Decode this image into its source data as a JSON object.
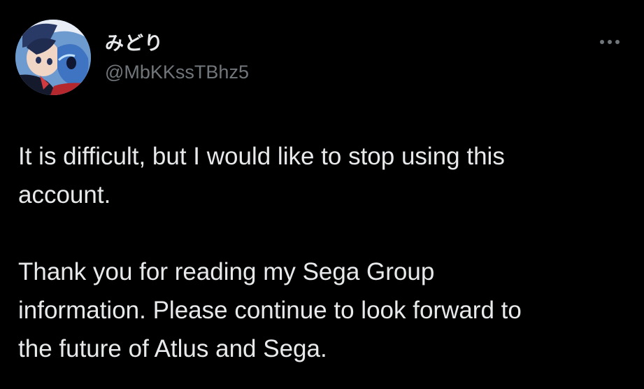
{
  "author": {
    "display_name": "みどり",
    "handle": "@MbKKssTBhz5",
    "avatar_icon": "anime-avatar-icon"
  },
  "actions": {
    "more_icon": "more-options-icon"
  },
  "tweet": {
    "paragraphs": [
      "It is difficult, but I would like to stop using this\naccount.",
      "Thank you for reading my Sega Group\ninformation. Please continue to look forward to\nthe future of Atlus and Sega."
    ]
  },
  "colors": {
    "background": "#000000",
    "text_primary": "#e7e9ea",
    "text_secondary": "#71767b"
  }
}
